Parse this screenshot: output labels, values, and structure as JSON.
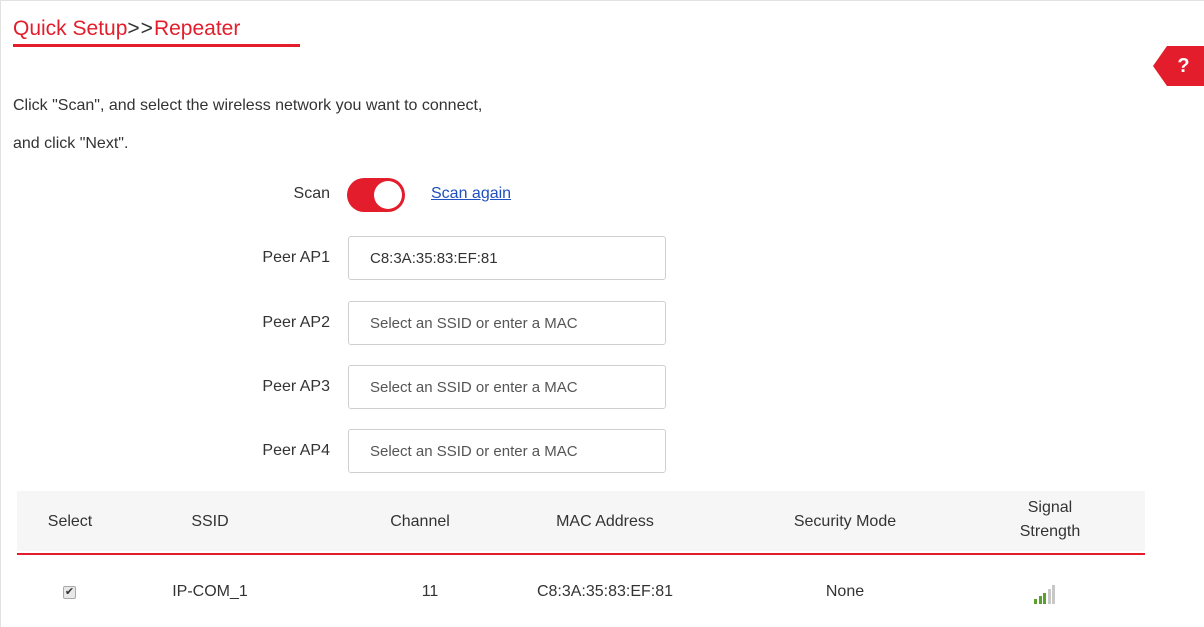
{
  "header": {
    "title_part1": "Quick Setup",
    "title_sep": ">>",
    "title_part2": "Repeater",
    "help_label": "?"
  },
  "intro": {
    "line1": "Click \"Scan\", and select the wireless network you want to connect,",
    "line2": "and click \"Next\"."
  },
  "scan": {
    "label": "Scan",
    "enabled": true,
    "scan_again": "Scan again"
  },
  "peers": [
    {
      "label": "Peer AP1",
      "value": "C8:3A:35:83:EF:81",
      "placeholder": "Select an SSID or enter a MAC"
    },
    {
      "label": "Peer AP2",
      "value": "",
      "placeholder": "Select an SSID or enter a MAC"
    },
    {
      "label": "Peer AP3",
      "value": "",
      "placeholder": "Select an SSID or enter a MAC"
    },
    {
      "label": "Peer AP4",
      "value": "",
      "placeholder": "Select an SSID or enter a MAC"
    }
  ],
  "table": {
    "headers": {
      "select": "Select",
      "ssid": "SSID",
      "channel": "Channel",
      "mac": "MAC Address",
      "security": "Security Mode",
      "signal_line1": "Signal",
      "signal_line2": "Strength"
    },
    "rows": [
      {
        "selected": true,
        "ssid": "IP-COM_1",
        "channel": "11",
        "mac": "C8:3A:35:83:EF:81",
        "security": "None",
        "signal_icon": "signal-strength-icon",
        "signal_bars": 3,
        "signal_max": 5
      }
    ]
  },
  "colors": {
    "accent": "#e31d2b",
    "link": "#1f4fc0",
    "signal": "#5aa02c",
    "signal_inactive": "#c8c8c8"
  }
}
